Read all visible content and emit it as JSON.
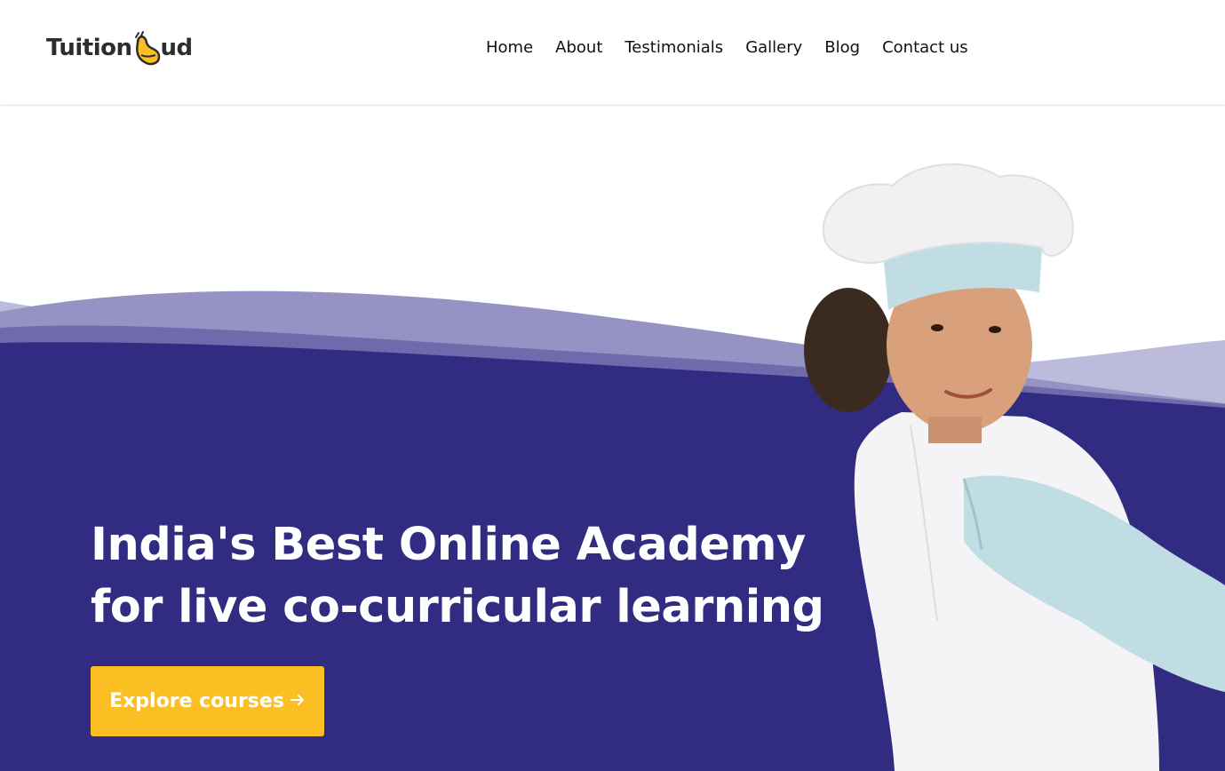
{
  "brand": {
    "name_part1": "Tuition",
    "name_part2": "ud",
    "accent_color": "#fbbf24"
  },
  "nav": {
    "items": [
      {
        "label": "Home"
      },
      {
        "label": "About"
      },
      {
        "label": "Testimonials"
      },
      {
        "label": "Gallery"
      },
      {
        "label": "Blog"
      },
      {
        "label": "Contact us"
      }
    ]
  },
  "hero": {
    "headline_line1": "India's Best Online Academy",
    "headline_line2": "for live co-curricular learning",
    "cta_label": "Explore courses",
    "cta_icon": "arrow-right-icon",
    "background_color": "#312c81",
    "image_subject": "child-chef-photo"
  }
}
